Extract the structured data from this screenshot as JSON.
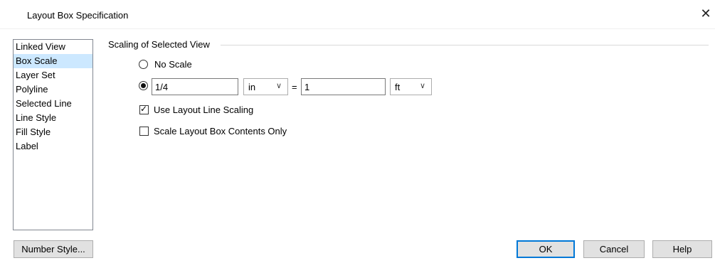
{
  "window": {
    "title": "Layout Box Specification",
    "close_glyph": "✕"
  },
  "sidebar": {
    "items": [
      {
        "label": "Linked View"
      },
      {
        "label": "Box Scale",
        "selected": true
      },
      {
        "label": "Layer Set"
      },
      {
        "label": "Polyline"
      },
      {
        "label": "Selected Line"
      },
      {
        "label": "Line Style"
      },
      {
        "label": "Fill Style"
      },
      {
        "label": "Label"
      }
    ]
  },
  "scaling": {
    "group_title": "Scaling of Selected View",
    "no_scale_label": "No Scale",
    "scale_mode": "custom",
    "left_value": "1/4",
    "left_unit": "in",
    "equals": "=",
    "right_value": "1",
    "right_unit": "ft",
    "use_layout_line_scaling": {
      "label": "Use Layout Line Scaling",
      "checked": true
    },
    "scale_contents_only": {
      "label": "Scale Layout Box Contents Only",
      "checked": false
    }
  },
  "buttons": {
    "number_style": "Number Style...",
    "ok": "OK",
    "cancel": "Cancel",
    "help": "Help"
  },
  "icons": {
    "combo_chevron": "chevron-down-icon",
    "close": "close-icon",
    "check": "checkmark-icon"
  }
}
